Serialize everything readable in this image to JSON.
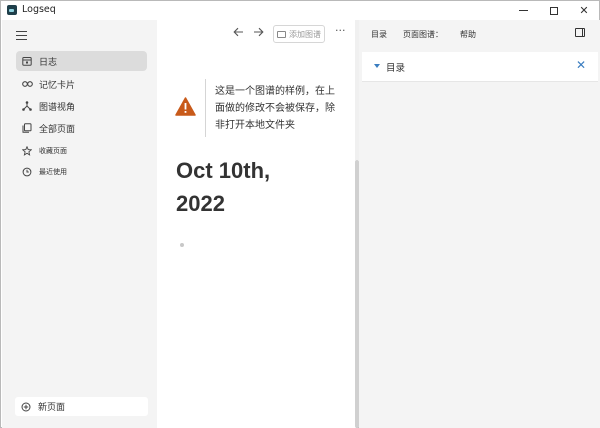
{
  "window": {
    "title": "Logseq"
  },
  "sidebar": {
    "items": [
      {
        "label": "日志",
        "icon": "calendar-icon",
        "active": true
      },
      {
        "label": "记忆卡片",
        "icon": "infinity-icon"
      },
      {
        "label": "图谱视角",
        "icon": "graph-icon"
      },
      {
        "label": "全部页面",
        "icon": "pages-icon"
      },
      {
        "label": "收藏页面",
        "icon": "star-icon"
      },
      {
        "label": "最近使用",
        "icon": "history-icon"
      }
    ],
    "new_page_label": "新页面"
  },
  "toolbar": {
    "add_graph_label": "添加图谱",
    "more_label": "···"
  },
  "warning": {
    "text": "这是一个图谱的样例，在上面做的修改不会被保存，除非打开本地文件夹"
  },
  "journal": {
    "title_line1": "Oct 10th,",
    "title_line2": "2022"
  },
  "right_sidebar": {
    "tabs": [
      "目录",
      "页面图谱：",
      "帮助"
    ],
    "contents_title": "目录"
  },
  "colors": {
    "accent": "#3a7dc0",
    "warning": "#c85a1a"
  }
}
